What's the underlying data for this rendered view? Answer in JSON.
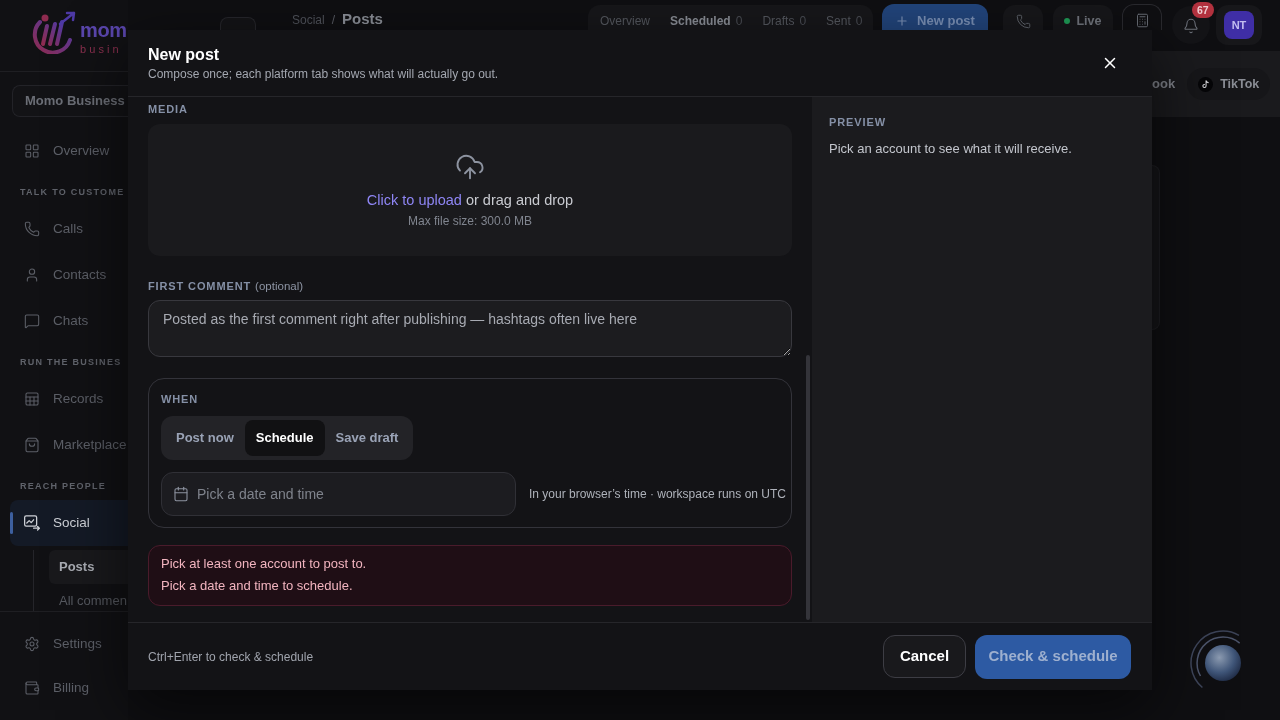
{
  "sidebar": {
    "logo": {
      "name": "mom",
      "tagline": "busin"
    },
    "workspace": "Momo Business",
    "nav": [
      {
        "kind": "item",
        "label": "Overview",
        "selected": false
      },
      {
        "kind": "section",
        "label": "TALK TO CUSTOME"
      },
      {
        "kind": "item",
        "label": "Calls",
        "selected": false
      },
      {
        "kind": "item",
        "label": "Contacts",
        "selected": false
      },
      {
        "kind": "item",
        "label": "Chats",
        "selected": false
      },
      {
        "kind": "section",
        "label": "RUN THE BUSINES"
      },
      {
        "kind": "item",
        "label": "Records",
        "selected": false
      },
      {
        "kind": "item",
        "label": "Marketplace",
        "selected": false
      },
      {
        "kind": "section",
        "label": "REACH PEOPLE"
      },
      {
        "kind": "item",
        "label": "Social",
        "selected": true,
        "children": [
          {
            "label": "Posts",
            "selected": true
          },
          {
            "label": "All commen",
            "selected": false
          }
        ]
      }
    ],
    "footer_nav": [
      {
        "label": "Settings"
      },
      {
        "label": "Billing"
      }
    ]
  },
  "topbar": {
    "breadcrumb": {
      "parent": "Social",
      "separator": "/",
      "current": "Posts"
    },
    "view_tabs": [
      {
        "label": "Overview",
        "selected": false
      },
      {
        "label": "Scheduled",
        "count": "0",
        "selected": true
      },
      {
        "label": "Drafts",
        "count": "0",
        "selected": false
      },
      {
        "label": "Sent",
        "count": "0",
        "selected": false
      }
    ],
    "new_post": "New post",
    "status": "Live",
    "notifications": "67",
    "avatar": "NT"
  },
  "platform_tabs": [
    {
      "kind": "partial",
      "label": "ook"
    },
    {
      "kind": "full",
      "label": "TikTok"
    }
  ],
  "modal": {
    "title": "New post",
    "subtitle": "Compose once; each platform tab shows what will actually go out.",
    "media": {
      "label": "MEDIA",
      "upload_link": "Click to upload",
      "upload_text": "or drag and drop",
      "limit": "Max file size: 300.0 MB"
    },
    "first_comment": {
      "label": "FIRST COMMENT",
      "note": "(optional)",
      "placeholder": "Posted as the first comment right after publishing — hashtags often live here"
    },
    "when": {
      "label": "WHEN",
      "options": [
        {
          "label": "Post now",
          "selected": false
        },
        {
          "label": "Schedule",
          "selected": true
        },
        {
          "label": "Save draft",
          "selected": false
        }
      ],
      "date_field": {
        "placeholder": "Pick a date and time"
      },
      "hint": "In your browser’s time · workspace runs on UTC"
    },
    "errors": [
      "Pick at least one account to post to.",
      "Pick a date and time to schedule."
    ],
    "preview": {
      "label": "PREVIEW",
      "text": "Pick an account to see what it will receive."
    },
    "footer": {
      "shortcut": "Ctrl+Enter to check & schedule",
      "cancel": "Cancel",
      "submit": {
        "label": "Check & schedule",
        "disabled": true
      }
    }
  }
}
